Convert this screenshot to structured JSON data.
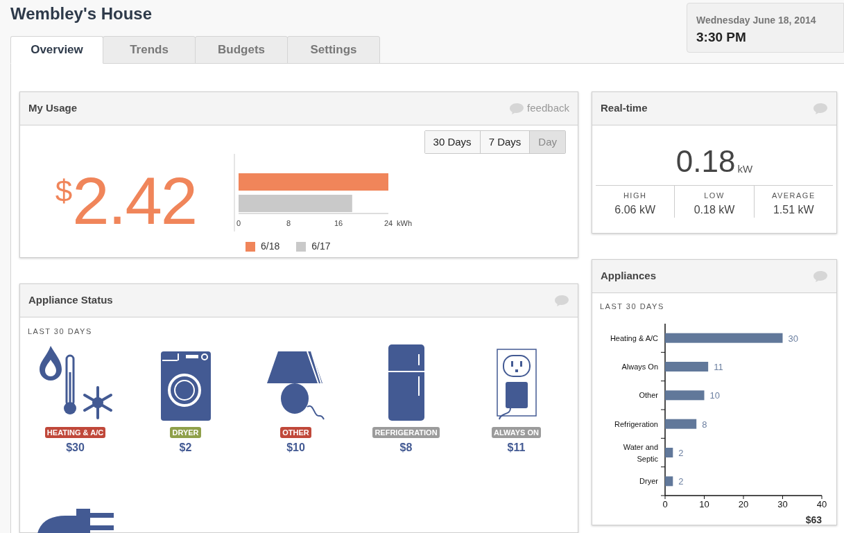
{
  "title": "Wembley's House",
  "clock": {
    "date": "Wednesday June 18, 2014",
    "time": "3:30 PM"
  },
  "tabs": [
    {
      "label": "Overview",
      "selected": true
    },
    {
      "label": "Trends",
      "selected": false
    },
    {
      "label": "Budgets",
      "selected": false
    },
    {
      "label": "Settings",
      "selected": false
    }
  ],
  "my_usage": {
    "title": "My Usage",
    "feedback": "feedback",
    "ranges": [
      {
        "label": "30 Days",
        "selected": false
      },
      {
        "label": "7 Days",
        "selected": false
      },
      {
        "label": "Day",
        "selected": true
      }
    ],
    "currency": "$",
    "amount": "2.42",
    "chart_data": {
      "type": "bar",
      "orientation": "horizontal",
      "xlabel": "kWh",
      "series": [
        {
          "name": "6/18",
          "color": "#f0855a",
          "values": [
            24
          ]
        },
        {
          "name": "6/17",
          "color": "#c9c9c9",
          "values": [
            18.2
          ]
        }
      ],
      "xlim": [
        0,
        24
      ],
      "xticks": [
        0,
        8,
        16,
        24
      ],
      "legend": "bottom"
    }
  },
  "realtime": {
    "title": "Real-time",
    "value": "0.18",
    "unit": "kW",
    "stats": [
      {
        "label": "HIGH",
        "value": "6.06 kW"
      },
      {
        "label": "LOW",
        "value": "0.18 kW"
      },
      {
        "label": "AVERAGE",
        "value": "1.51 kW"
      }
    ]
  },
  "appliance_status": {
    "title": "Appliance Status",
    "period": "LAST 30 DAYS",
    "items": [
      {
        "kind": "climate",
        "label": "HEATING & A/C",
        "color": "#c0483a",
        "amount": "$30"
      },
      {
        "kind": "washer",
        "label": "DRYER",
        "color": "#8fa04a",
        "amount": "$2"
      },
      {
        "kind": "lamp",
        "label": "OTHER",
        "color": "#c0483a",
        "amount": "$10"
      },
      {
        "kind": "fridge",
        "label": "REFRIGERATION",
        "color": "#9b9b9b",
        "amount": "$8"
      },
      {
        "kind": "outlet",
        "label": "ALWAYS ON",
        "color": "#9b9b9b",
        "amount": "$11"
      },
      {
        "kind": "plug"
      }
    ]
  },
  "appliances": {
    "title": "Appliances",
    "period": "LAST 30 DAYS",
    "total": "$63",
    "chart_data": {
      "type": "bar",
      "orientation": "horizontal",
      "categories": [
        "Heating & A/C",
        "Always On",
        "Other",
        "Refrigeration",
        "Water and Septic",
        "Dryer"
      ],
      "series": [
        {
          "color": "#61789a",
          "values": [
            30,
            11,
            10,
            8,
            2,
            2
          ]
        }
      ],
      "xlim": [
        0,
        40
      ],
      "xticks": [
        0,
        10,
        20,
        30,
        40
      ],
      "data_labels": true
    }
  }
}
